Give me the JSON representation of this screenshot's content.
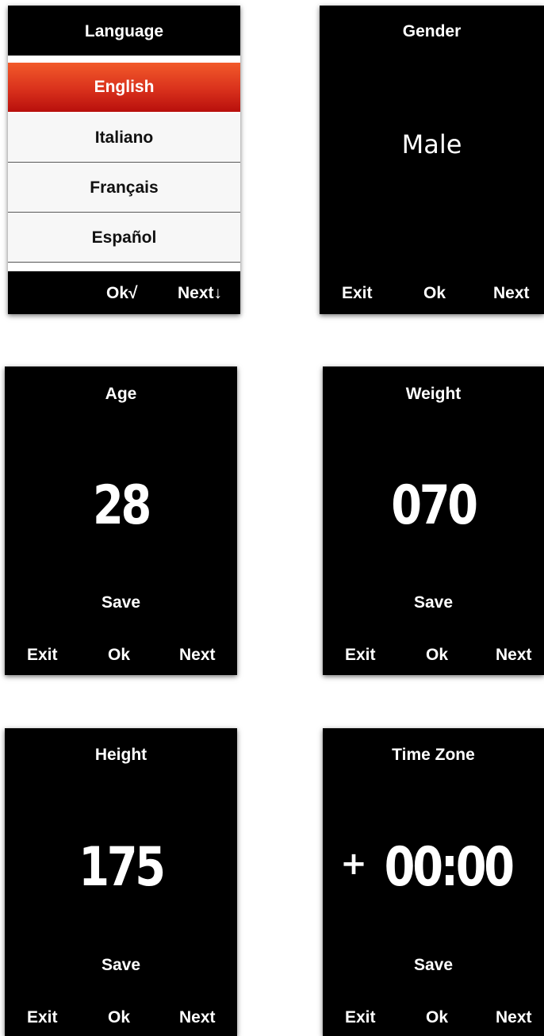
{
  "language_screen": {
    "title": "Language",
    "items": [
      {
        "label": "English",
        "selected": true
      },
      {
        "label": "Italiano",
        "selected": false
      },
      {
        "label": "Français",
        "selected": false
      },
      {
        "label": "Español",
        "selected": false
      }
    ],
    "ok_label": "Ok√",
    "next_label": "Next↓"
  },
  "gender_screen": {
    "title": "Gender",
    "value": "Male",
    "exit_label": "Exit",
    "ok_label": "Ok",
    "next_label": "Next"
  },
  "age_screen": {
    "title": "Age",
    "value": "28",
    "save_label": "Save",
    "exit_label": "Exit",
    "ok_label": "Ok",
    "next_label": "Next"
  },
  "weight_screen": {
    "title": "Weight",
    "value": "070",
    "save_label": "Save",
    "exit_label": "Exit",
    "ok_label": "Ok",
    "next_label": "Next"
  },
  "height_screen": {
    "title": "Height",
    "value": "175",
    "save_label": "Save",
    "exit_label": "Exit",
    "ok_label": "Ok",
    "next_label": "Next"
  },
  "timezone_screen": {
    "title": "Time Zone",
    "sign": "+",
    "value": "00:00",
    "save_label": "Save",
    "exit_label": "Exit",
    "ok_label": "Ok",
    "next_label": "Next"
  },
  "colors": {
    "screen_bg": "#000000",
    "selected_item": "#d9311c",
    "text": "#ffffff"
  }
}
